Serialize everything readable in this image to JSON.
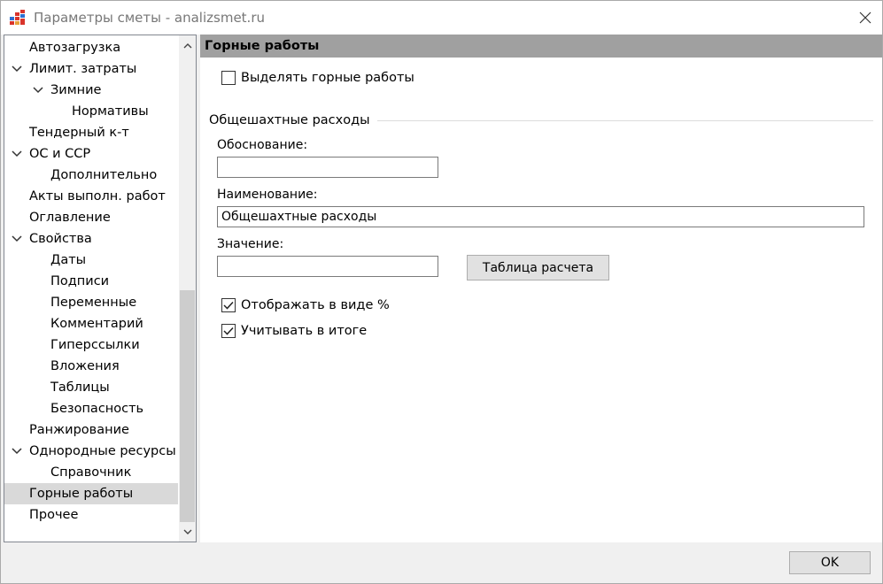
{
  "window": {
    "title": "Параметры сметы - analizsmet.ru",
    "icon": "app-grid-icon",
    "close_icon": "close-icon"
  },
  "tree": {
    "items": [
      {
        "label": "Автозагрузка",
        "level": 0,
        "expandable": false,
        "selected": false
      },
      {
        "label": "Лимит. затраты",
        "level": 0,
        "expandable": true,
        "selected": false
      },
      {
        "label": "Зимние",
        "level": 1,
        "expandable": true,
        "selected": false
      },
      {
        "label": "Нормативы",
        "level": 2,
        "expandable": false,
        "selected": false
      },
      {
        "label": "Тендерный к-т",
        "level": 0,
        "expandable": false,
        "selected": false
      },
      {
        "label": "ОС и ССР",
        "level": 0,
        "expandable": true,
        "selected": false
      },
      {
        "label": "Дополнительно",
        "level": 1,
        "expandable": false,
        "selected": false
      },
      {
        "label": "Акты выполн. работ",
        "level": 0,
        "expandable": false,
        "selected": false
      },
      {
        "label": "Оглавление",
        "level": 0,
        "expandable": false,
        "selected": false
      },
      {
        "label": "Свойства",
        "level": 0,
        "expandable": true,
        "selected": false
      },
      {
        "label": "Даты",
        "level": 1,
        "expandable": false,
        "selected": false
      },
      {
        "label": "Подписи",
        "level": 1,
        "expandable": false,
        "selected": false
      },
      {
        "label": "Переменные",
        "level": 1,
        "expandable": false,
        "selected": false
      },
      {
        "label": "Комментарий",
        "level": 1,
        "expandable": false,
        "selected": false
      },
      {
        "label": "Гиперссылки",
        "level": 1,
        "expandable": false,
        "selected": false
      },
      {
        "label": "Вложения",
        "level": 1,
        "expandable": false,
        "selected": false
      },
      {
        "label": "Таблицы",
        "level": 1,
        "expandable": false,
        "selected": false
      },
      {
        "label": "Безопасность",
        "level": 1,
        "expandable": false,
        "selected": false
      },
      {
        "label": "Ранжирование",
        "level": 0,
        "expandable": false,
        "selected": false
      },
      {
        "label": "Однородные ресурсы",
        "level": 0,
        "expandable": true,
        "selected": false
      },
      {
        "label": "Справочник",
        "level": 1,
        "expandable": false,
        "selected": false
      },
      {
        "label": "Горные работы",
        "level": 0,
        "expandable": false,
        "selected": true
      },
      {
        "label": "Прочее",
        "level": 0,
        "expandable": false,
        "selected": false
      }
    ]
  },
  "panel": {
    "header": "Горные работы",
    "highlight_checkbox": {
      "label": "Выделять горные работы",
      "checked": false
    },
    "group": {
      "title": "Общешахтные расходы",
      "basis_label": "Обоснование:",
      "basis_value": "",
      "name_label": "Наименование:",
      "name_value": "Общешахтные расходы",
      "value_label": "Значение:",
      "value_value": "",
      "calc_table_button": "Таблица расчета",
      "show_percent": {
        "label": "Отображать в виде %",
        "checked": true
      },
      "include_total": {
        "label": "Учитывать в итоге",
        "checked": true
      }
    }
  },
  "footer": {
    "ok_button": "OK"
  },
  "colors": {
    "header_bg": "#a0a0a0",
    "selection_bg": "#d9d9d9",
    "window_bg": "#f0f0f0"
  }
}
